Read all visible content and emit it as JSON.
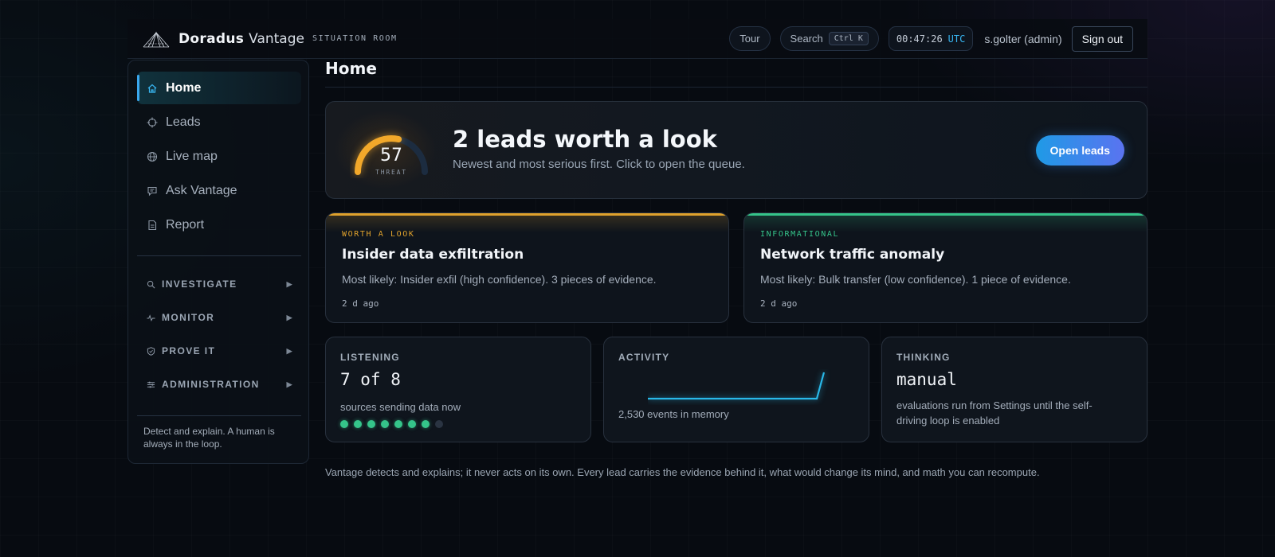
{
  "header": {
    "brand_name": "Doradus",
    "brand_sub": "Vantage",
    "brand_tag": "SITUATION ROOM",
    "tour_label": "Tour",
    "search_label": "Search",
    "search_shortcut": "Ctrl K",
    "clock_time": "00:47:26",
    "clock_zone": "UTC",
    "user": "s.golter (admin)",
    "signout_label": "Sign out"
  },
  "sidebar": {
    "nav": [
      {
        "label": "Home",
        "icon": "home-icon",
        "active": true
      },
      {
        "label": "Leads",
        "icon": "crosshair-icon"
      },
      {
        "label": "Live map",
        "icon": "globe-icon"
      },
      {
        "label": "Ask Vantage",
        "icon": "chat-icon"
      },
      {
        "label": "Report",
        "icon": "document-icon"
      }
    ],
    "groups": [
      {
        "label": "INVESTIGATE",
        "icon": "search-icon"
      },
      {
        "label": "MONITOR",
        "icon": "pulse-icon"
      },
      {
        "label": "PROVE IT",
        "icon": "shield-icon"
      },
      {
        "label": "ADMINISTRATION",
        "icon": "sliders-icon"
      }
    ],
    "footer": "Detect and explain. A human is always in the loop."
  },
  "main": {
    "title": "Home",
    "hero": {
      "threat_value": "57",
      "threat_label": "THREAT",
      "threat_fraction": 0.57,
      "headline": "2 leads worth a look",
      "subtext": "Newest and most serious first. Click to open the queue.",
      "cta_label": "Open leads"
    },
    "leads": [
      {
        "tag": "WORTH A LOOK",
        "title": "Insider data exfiltration",
        "desc": "Most likely: Insider exfil (high confidence). 3 pieces of evidence.",
        "time": "2 d ago",
        "color": "#e0a22c"
      },
      {
        "tag": "INFORMATIONAL",
        "title": "Network traffic anomaly",
        "desc": "Most likely: Bulk transfer (low confidence). 1 piece of evidence.",
        "time": "2 d ago",
        "color": "#35c48a"
      }
    ],
    "stats": {
      "listening": {
        "label": "LISTENING",
        "value": "7 of 8",
        "sub": "sources sending data now",
        "active": 7,
        "total": 8
      },
      "activity": {
        "label": "ACTIVITY",
        "sub": "2,530 events in memory"
      },
      "thinking": {
        "label": "THINKING",
        "value": "manual",
        "sub": "evaluations run from Settings until the self-driving loop is enabled"
      }
    },
    "footer_note": "Vantage detects and explains; it never acts on its own. Every lead carries the evidence behind it, what would change its mind, and math you can recompute."
  },
  "colors": {
    "accent": "#38b6f2",
    "warn": "#e0a22c",
    "ok": "#35c48a",
    "dot_off": "#2a3442"
  }
}
